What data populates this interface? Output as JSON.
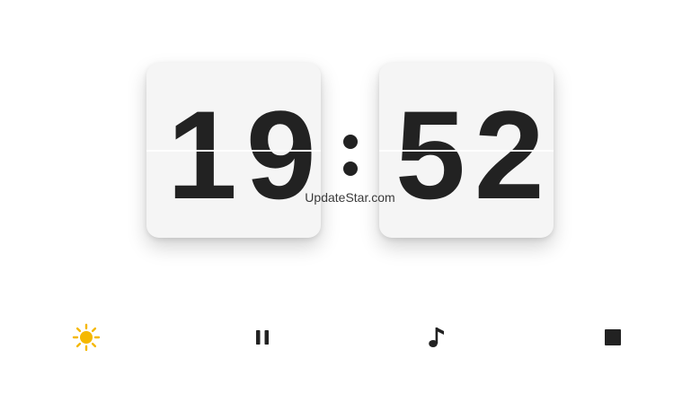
{
  "clock": {
    "hours": "19",
    "minutes": "52"
  },
  "watermark": "UpdateStar.com",
  "toolbar": {
    "buttons": [
      {
        "name": "brightness",
        "icon": "sun-icon",
        "color": "#f5b800"
      },
      {
        "name": "pause",
        "icon": "pause-icon",
        "color": "#222222"
      },
      {
        "name": "music",
        "icon": "music-note-icon",
        "color": "#222222"
      },
      {
        "name": "stop",
        "icon": "stop-icon",
        "color": "#222222"
      }
    ]
  }
}
